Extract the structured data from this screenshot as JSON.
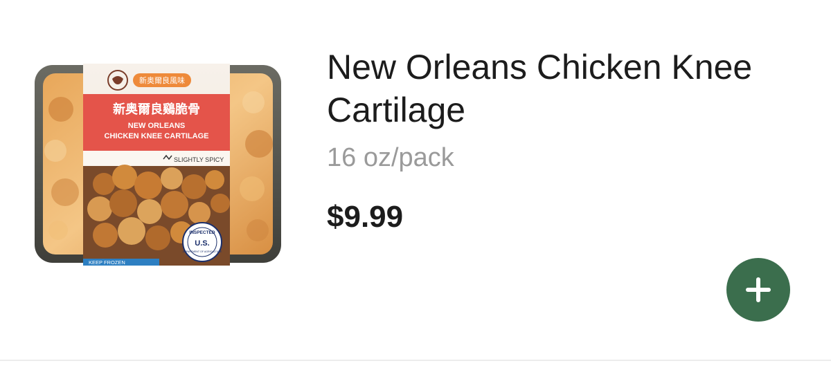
{
  "product": {
    "title": "New Orleans Chicken Knee Cartilage",
    "size": "16 oz/pack",
    "price": "$9.99",
    "image_icon": "product-photo"
  },
  "package_label": {
    "chinese_top": "新奥爾良風味",
    "chinese_main": "新奥爾良鷄脆骨",
    "english_line1": "NEW ORLEANS",
    "english_line2": "CHICKEN KNEE CARTILAGE",
    "spice": "SLIGHTLY SPICY",
    "seal_top": "INSPECTED",
    "seal_mid": "U.S.",
    "seal_bottom": "DEPARTMENT OF AGRICULTURE",
    "keep_frozen": "KEEP FROZEN"
  },
  "add_button": {
    "icon": "plus-icon"
  },
  "colors": {
    "accent": "#3b6e4d",
    "title": "#1c1c1c",
    "muted": "#9a9a9a",
    "divider": "#ececec"
  }
}
